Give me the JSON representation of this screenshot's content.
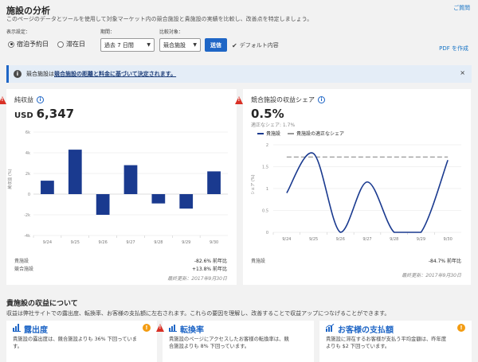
{
  "header": {
    "title": "施設の分析",
    "subtitle": "このページのデータとツールを使用して対象マーケット内の競合施設と貴施設の実績を比較し、改善点を特定しましょう。",
    "help_link": "ご質問"
  },
  "controls": {
    "display_label": "表示設定：",
    "radio_booking": "宿泊予約日",
    "radio_stay": "滞在日",
    "period_label": "期間：",
    "period_value": "過去 7 日間",
    "compare_label": "比較対象：",
    "compare_value": "競合施設",
    "submit_label": "送信",
    "default_label": "デフォルト内容",
    "pdf_label": "PDF を作成"
  },
  "banner": {
    "prefix": "競合施設は",
    "link": "競合施設の距離と料金に基づいて決定されます。",
    "close": "×"
  },
  "card_left": {
    "title": "純収益",
    "currency": "USD",
    "value": "6,347",
    "ylabel": "純収益 (%)",
    "legend_row1_label": "貴施設",
    "legend_row1_value": "-82.6% 前年比",
    "legend_row2_label": "競合施設",
    "legend_row2_value": "+13.8% 前年比",
    "updated": "最終更新：2017年9月30日"
  },
  "card_right": {
    "title": "競合施設の収益シェア",
    "value": "0.5%",
    "fair_share": "適正なシェア: 1.7%",
    "legend_own": "貴施設",
    "legend_fair": "貴施設の適正なシェア",
    "ylabel": "シェア (%)",
    "legend_row1_label": "貴施設",
    "legend_row1_value": "-84.7% 前年比",
    "updated": "最終更新：2017年9月30日"
  },
  "section": {
    "title": "貴施設の収益について",
    "subtitle": "収益は弊社サイトでの露出度、転換率、お客様の支払額に左右されます。これらの要因を理解し、改善することで収益アップにつなげることができます。"
  },
  "metrics": [
    {
      "title": "露出度",
      "line1": "貴施設の露出度は、競合施設よりも 36% 下回っていま",
      "line2": "す。"
    },
    {
      "title": "転換率",
      "line1": "貴施設のページにアクセスしたお客様の転換率は、競",
      "line2": "合施設よりも 8% 下回っています。"
    },
    {
      "title": "お客様の支払額",
      "line1": "貴施設に滞在するお客様が支払う平均金額は、昨年度",
      "line2": "よりも $2 下回っています。"
    }
  ],
  "colors": {
    "accent": "#1f66c6",
    "bar": "#1a3a8f",
    "warn": "#d93025",
    "orange": "#f39c12"
  },
  "chart_data": [
    {
      "type": "bar",
      "title": "純収益",
      "categories": [
        "9/24",
        "9/25",
        "9/26",
        "9/27",
        "9/28",
        "9/29",
        "9/30"
      ],
      "values": [
        1.3,
        4.3,
        -2.0,
        2.8,
        -0.9,
        -1.4,
        2.2
      ],
      "ylabel": "純収益 (%)",
      "yticks": [
        "6k",
        "4k",
        "2k",
        "0",
        "-2k",
        "-4k"
      ],
      "ylim": [
        -4,
        6
      ]
    },
    {
      "type": "line",
      "title": "競合施設の収益シェア",
      "x": [
        "9/24",
        "9/25",
        "9/26",
        "9/27",
        "9/28",
        "9/29",
        "9/30"
      ],
      "ylim": [
        0,
        2
      ],
      "yticks": [
        "2",
        "1.5",
        "1",
        "0.5",
        "0"
      ],
      "ylabel": "シェア (%)",
      "series": [
        {
          "name": "貴施設",
          "values": [
            0.9,
            1.8,
            0.0,
            1.15,
            0.0,
            0.0,
            1.65
          ],
          "style": "solid"
        },
        {
          "name": "貴施設の適正なシェア",
          "values": [
            1.72,
            1.72,
            1.72,
            1.72,
            1.72,
            1.72,
            1.72
          ],
          "style": "dashed"
        }
      ]
    }
  ]
}
